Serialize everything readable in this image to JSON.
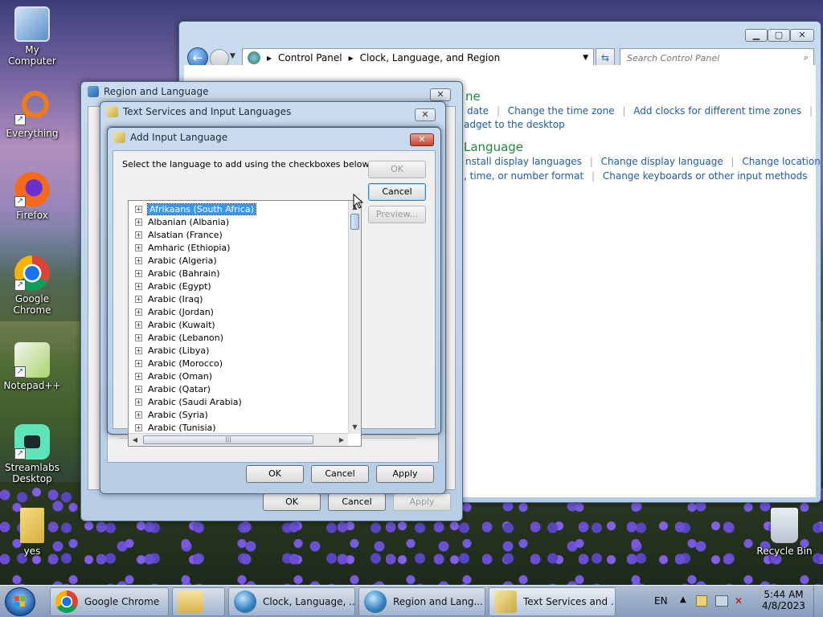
{
  "desktop": {
    "icons": [
      {
        "label": "My Computer"
      },
      {
        "label": "Everything"
      },
      {
        "label": "Firefox"
      },
      {
        "label": "Google Chrome"
      },
      {
        "label": "Notepad++"
      },
      {
        "label": "Streamlabs Desktop"
      },
      {
        "label": "yes"
      },
      {
        "label": "Recycle Bin"
      }
    ]
  },
  "control_panel": {
    "breadcrumb": [
      "Control Panel",
      "Clock, Language, and Region"
    ],
    "search_placeholder": "Search Control Panel",
    "section1_title_partial": "ne",
    "section1_links": [
      "date",
      "Change the time zone",
      "Add clocks for different time zones"
    ],
    "section1_line2": "adget to the desktop",
    "section2_title_partial": "Language",
    "section2_links": [
      "nstall display languages",
      "Change display language",
      "Change location"
    ],
    "section2_line2": [
      ", time, or number format",
      "Change keyboards or other input methods"
    ]
  },
  "region_dialog": {
    "title": "Region and Language",
    "ok": "OK",
    "cancel": "Cancel",
    "apply": "Apply"
  },
  "text_services_dialog": {
    "title": "Text Services and Input Languages",
    "ok": "OK",
    "cancel": "Cancel",
    "apply": "Apply"
  },
  "add_input_dialog": {
    "title": "Add Input Language",
    "instruction": "Select the language to add using the checkboxes below.",
    "ok": "OK",
    "cancel": "Cancel",
    "preview": "Preview...",
    "languages": [
      "Afrikaans (South Africa)",
      "Albanian (Albania)",
      "Alsatian (France)",
      "Amharic (Ethiopia)",
      "Arabic (Algeria)",
      "Arabic (Bahrain)",
      "Arabic (Egypt)",
      "Arabic (Iraq)",
      "Arabic (Jordan)",
      "Arabic (Kuwait)",
      "Arabic (Lebanon)",
      "Arabic (Libya)",
      "Arabic (Morocco)",
      "Arabic (Oman)",
      "Arabic (Qatar)",
      "Arabic (Saudi Arabia)",
      "Arabic (Syria)",
      "Arabic (Tunisia)"
    ],
    "selected_index": 0
  },
  "taskbar": {
    "tasks": [
      "Google Chrome",
      "Clock, Language, ...",
      "Region and Lang...",
      "Text Services and ..."
    ],
    "lang": "EN",
    "time": "5:44 AM",
    "date": "4/8/2023"
  }
}
